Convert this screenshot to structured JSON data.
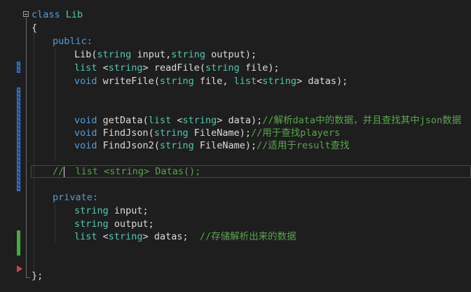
{
  "code": {
    "l1": [
      "class",
      "Lib"
    ],
    "l2": "{",
    "l3": "public:",
    "l4": [
      "Lib",
      "(",
      "string",
      " input,",
      "string",
      " output);"
    ],
    "l5": [
      "list",
      " <",
      "string",
      "> ",
      "readFile",
      "(",
      "string",
      " file);"
    ],
    "l6": [
      "void",
      " ",
      "writeFile",
      "(",
      "string",
      " file, ",
      "list",
      "<",
      "string",
      "> datas);"
    ],
    "l7": [
      "void",
      " ",
      "getData",
      "(",
      "list",
      " <",
      "string",
      "> data);",
      "//解析data中的数据，并且查找其中json数据"
    ],
    "l8": [
      "void",
      " ",
      "FindJson",
      "(",
      "string",
      " FileName);",
      "//用于查找players"
    ],
    "l9": [
      "void",
      " ",
      "FindJson2",
      "(",
      "string",
      " FileName);",
      "//适用于result查找"
    ],
    "l10": [
      "//",
      "  list <string> Datas();"
    ],
    "l11": "private:",
    "l12": [
      "string",
      " input;"
    ],
    "l13": [
      "string",
      " output;"
    ],
    "l14": [
      "list",
      " <",
      "string",
      "> datas;  ",
      "//存储解析出来的数据"
    ],
    "l15": "};"
  },
  "colors": {
    "background": "#1e1e1e",
    "keyword": "#569cd6",
    "type": "#4ec9b0",
    "comment": "#57a64a",
    "text": "#dcdcdc",
    "modified_marker": "#2b6dbf",
    "saved_marker": "#3fae3f",
    "breakpoint_arrow": "#d94040"
  },
  "icons": [
    "fold-collapse-icon",
    "next-statement-arrow-icon"
  ]
}
